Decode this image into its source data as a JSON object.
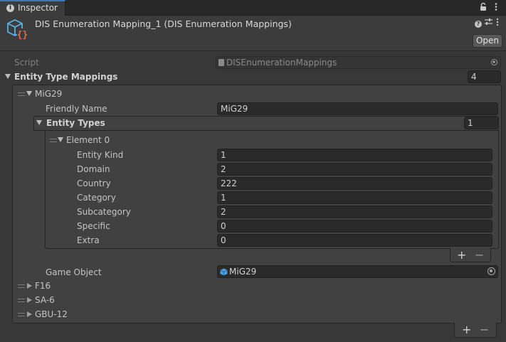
{
  "window": {
    "tab_label": "Inspector",
    "tab_icon": "info-icon",
    "lock_icon": "lock-icon",
    "menu_icon": "kebab-menu-icon"
  },
  "header": {
    "title": "DIS Enumeration Mapping_1 (DIS Enumeration Mappings)",
    "asset_icon": "scriptable-object-icon",
    "open_label": "Open",
    "help_icon": "help-icon",
    "settings_icon": "preset-sliders-icon",
    "overflow_icon": "kebab-menu-icon"
  },
  "script_row": {
    "label": "Script",
    "value": "DISEnumerationMappings"
  },
  "mappings": {
    "label": "Entity Type Mappings",
    "count": "4",
    "items": [
      {
        "name": "MiG29",
        "friendly_name_label": "Friendly Name",
        "friendly_name": "MiG29",
        "entity_types_label": "Entity Types",
        "entity_types_count": "1",
        "element": {
          "label": "Element 0",
          "fields": [
            {
              "label": "Entity Kind",
              "value": "1"
            },
            {
              "label": "Domain",
              "value": "2"
            },
            {
              "label": "Country",
              "value": "222"
            },
            {
              "label": "Category",
              "value": "1"
            },
            {
              "label": "Subcategory",
              "value": "2"
            },
            {
              "label": "Specific",
              "value": "0"
            },
            {
              "label": "Extra",
              "value": "0"
            }
          ]
        },
        "game_object_label": "Game Object",
        "game_object": "MiG29"
      },
      {
        "name": "F16"
      },
      {
        "name": "SA-6"
      },
      {
        "name": "GBU-12"
      }
    ]
  },
  "list_controls": {
    "add": "+",
    "remove": "−"
  },
  "colors": {
    "accent": "#3a79bb",
    "background": "#383838",
    "field": "#2a2a2a"
  }
}
